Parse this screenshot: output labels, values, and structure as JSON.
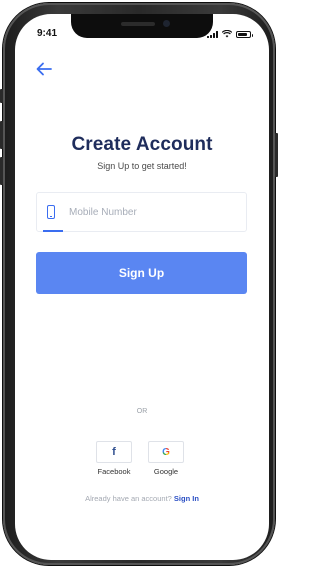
{
  "status_bar": {
    "time": "9:41",
    "battery_level": 0.85
  },
  "header": {
    "back_icon": "arrow-left-icon"
  },
  "main": {
    "title": "Create Account",
    "subtitle": "Sign Up to get started!",
    "mobile_field": {
      "icon": "mobile-phone-icon",
      "value": "",
      "placeholder": "Mobile Number"
    },
    "signup_label": "Sign Up",
    "or_label": "OR"
  },
  "social": [
    {
      "name": "Facebook",
      "glyph": "f",
      "icon": "facebook-icon"
    },
    {
      "name": "Google",
      "glyph": "G",
      "icon": "google-icon"
    }
  ],
  "footer": {
    "prompt": "Already have an account?",
    "signin_label": "Sign In"
  },
  "colors": {
    "accent": "#5a86f2",
    "title": "#1f2d5c",
    "link": "#2a4fc4",
    "icon": "#3a6df0"
  }
}
